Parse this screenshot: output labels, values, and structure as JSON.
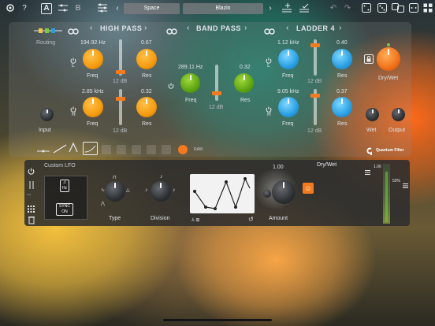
{
  "toolbar": {
    "help": "?",
    "slot_a": "A",
    "slot_b": "B",
    "preset_left": "Space",
    "preset_right": "Blazin"
  },
  "filters": {
    "high_pass": "HIGH PASS",
    "band_pass": "BAND PASS",
    "ladder": "LADDER 4",
    "routing": "Routing",
    "input": "Input",
    "dry_wet": "Dry/Wet",
    "wet": "Wet",
    "output": "Output",
    "freq": "Freq",
    "res": "Res",
    "db12": "12 dB",
    "l": "L",
    "r": "R",
    "hp_freq_l": "194.92 Hz",
    "hp_res_l": "0.67",
    "hp_freq_r": "2.85 kHz",
    "hp_res_r": "0.32",
    "bp_freq": "289.11 Hz",
    "bp_res": "0.32",
    "ld_freq_l": "1.12 kHz",
    "ld_res_l": "0.40",
    "ld_freq_r": "9.05 kHz",
    "ld_res_r": "0.37",
    "product": "Quantum Filter",
    "shape_label": "RAW"
  },
  "lfo": {
    "title": "Custom LFO",
    "unit": "Hz",
    "sync": "SYNC",
    "sync_state": "ON",
    "type": "Type",
    "division": "Division",
    "amount": "Amount",
    "amount_value": "1.00",
    "dry_wet": "Dry/Wet",
    "meter_top": "1.06",
    "meter_mid": "50%"
  },
  "colors": {
    "accent": "#f47a1e",
    "blue": "#2a9fe4",
    "green": "#5da413"
  }
}
